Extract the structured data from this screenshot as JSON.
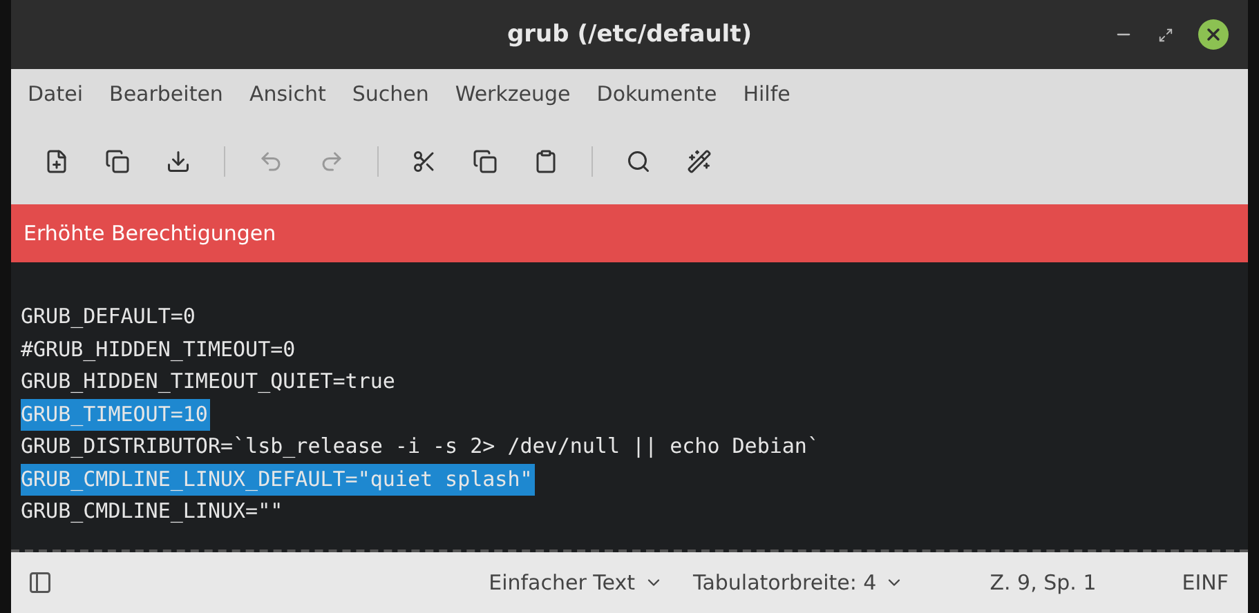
{
  "window": {
    "title": "grub (/etc/default)"
  },
  "menu": [
    "Datei",
    "Bearbeiten",
    "Ansicht",
    "Suchen",
    "Werkzeuge",
    "Dokumente",
    "Hilfe"
  ],
  "toolbar": [
    {
      "kind": "new"
    },
    {
      "kind": "open"
    },
    {
      "kind": "save"
    },
    {
      "kind": "sep"
    },
    {
      "kind": "undo"
    },
    {
      "kind": "redo"
    },
    {
      "kind": "sep"
    },
    {
      "kind": "cut"
    },
    {
      "kind": "copy"
    },
    {
      "kind": "paste"
    },
    {
      "kind": "sep"
    },
    {
      "kind": "search"
    },
    {
      "kind": "replace"
    }
  ],
  "banner": "Erhöhte Berechtigungen",
  "lines": [
    {
      "text": "GRUB_DEFAULT=0",
      "selected": false
    },
    {
      "text": "#GRUB_HIDDEN_TIMEOUT=0",
      "selected": false
    },
    {
      "text": "GRUB_HIDDEN_TIMEOUT_QUIET=true",
      "selected": false
    },
    {
      "text": "GRUB_TIMEOUT=10",
      "selected": true
    },
    {
      "text": "GRUB_DISTRIBUTOR=`lsb_release -i -s 2> /dev/null || echo Debian`",
      "selected": false
    },
    {
      "text": "GRUB_CMDLINE_LINUX_DEFAULT=\"quiet splash\"",
      "selected": true
    },
    {
      "text": "GRUB_CMDLINE_LINUX=\"\"",
      "selected": false
    }
  ],
  "status_bar": {
    "language": "Einfacher Text",
    "tab_width": "Tabulatorbreite: 4",
    "position": "Z. 9, Sp. 1",
    "mode": "EINF"
  }
}
